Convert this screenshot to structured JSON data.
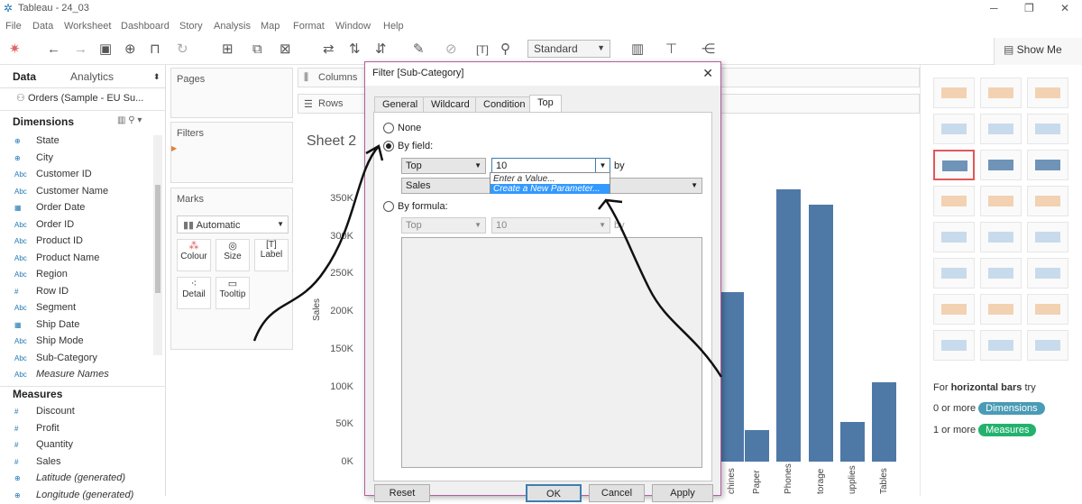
{
  "app": {
    "title": "Tableau - 24_03"
  },
  "menu": [
    "File",
    "Data",
    "Worksheet",
    "Dashboard",
    "Story",
    "Analysis",
    "Map",
    "Format",
    "Window",
    "Help"
  ],
  "toolbar": {
    "standard_label": "Standard",
    "show_me_label": "Show Me"
  },
  "data_pane": {
    "tab_data": "Data",
    "tab_analytics": "Analytics",
    "datasource": "Orders (Sample - EU Su...",
    "dimensions_header": "Dimensions",
    "dimensions": [
      {
        "icon": "globe",
        "label": "State"
      },
      {
        "icon": "globe",
        "label": "City"
      },
      {
        "icon": "Abc",
        "label": "Customer ID"
      },
      {
        "icon": "Abc",
        "label": "Customer Name"
      },
      {
        "icon": "calendar",
        "label": "Order Date"
      },
      {
        "icon": "Abc",
        "label": "Order ID"
      },
      {
        "icon": "Abc",
        "label": "Product ID"
      },
      {
        "icon": "Abc",
        "label": "Product Name"
      },
      {
        "icon": "Abc",
        "label": "Region"
      },
      {
        "icon": "#",
        "label": "Row ID"
      },
      {
        "icon": "Abc",
        "label": "Segment"
      },
      {
        "icon": "calendar",
        "label": "Ship Date"
      },
      {
        "icon": "Abc",
        "label": "Ship Mode"
      },
      {
        "icon": "Abc",
        "label": "Sub-Category"
      },
      {
        "icon": "Abc",
        "label": "Measure Names"
      }
    ],
    "measures_header": "Measures",
    "measures": [
      {
        "icon": "#",
        "label": "Discount"
      },
      {
        "icon": "#",
        "label": "Profit"
      },
      {
        "icon": "#",
        "label": "Quantity"
      },
      {
        "icon": "#",
        "label": "Sales"
      },
      {
        "icon": "globe",
        "label": "Latitude (generated)"
      },
      {
        "icon": "globe",
        "label": "Longitude (generated)"
      }
    ]
  },
  "shelves": {
    "pages": "Pages",
    "filters": "Filters",
    "marks": "Marks",
    "marks_type": "Automatic",
    "mark_buttons": [
      "Colour",
      "Size",
      "Label",
      "Detail",
      "Tooltip"
    ],
    "columns": "Columns",
    "rows": "Rows"
  },
  "sheet": {
    "title": "Sheet 2"
  },
  "chart_data": {
    "type": "bar",
    "ylabel": "Sales",
    "yticks": [
      "350K",
      "300K",
      "250K",
      "200K",
      "150K",
      "100K",
      "50K",
      "0K"
    ],
    "ylim": [
      0,
      350000
    ],
    "categories": [
      "Machines",
      "Paper",
      "Phones",
      "Storage",
      "Supplies",
      "Tables"
    ],
    "category_labels": [
      "chines",
      "Paper",
      "Phones",
      "torage",
      "upplies",
      "Tables"
    ],
    "values": [
      225000,
      42000,
      362000,
      342000,
      53000,
      105000
    ]
  },
  "dialog": {
    "title": "Filter [Sub-Category]",
    "tabs": [
      "General",
      "Wildcard",
      "Condition",
      "Top"
    ],
    "none_label": "None",
    "by_field_label": "By field:",
    "top_value": "Top",
    "count_value": "10",
    "by_label": "by",
    "field_value": "Sales",
    "by_formula_label": "By formula:",
    "formula_top": "Top",
    "formula_count": "10",
    "formula_by": "by",
    "dropdown_options": [
      "Enter a Value...",
      "Create a New Parameter..."
    ],
    "buttons": {
      "reset": "Reset",
      "ok": "OK",
      "cancel": "Cancel",
      "apply": "Apply"
    }
  },
  "show_me": {
    "hint_prefix": "For",
    "hint_bold": "horizontal bars",
    "hint_suffix": "try",
    "dim_prefix": "0 or more",
    "dim_pill": "Dimensions",
    "meas_prefix": "1 or more",
    "meas_pill": "Measures",
    "pill_dim_color": "#4a9bb5",
    "pill_meas_color": "#23b26d"
  }
}
